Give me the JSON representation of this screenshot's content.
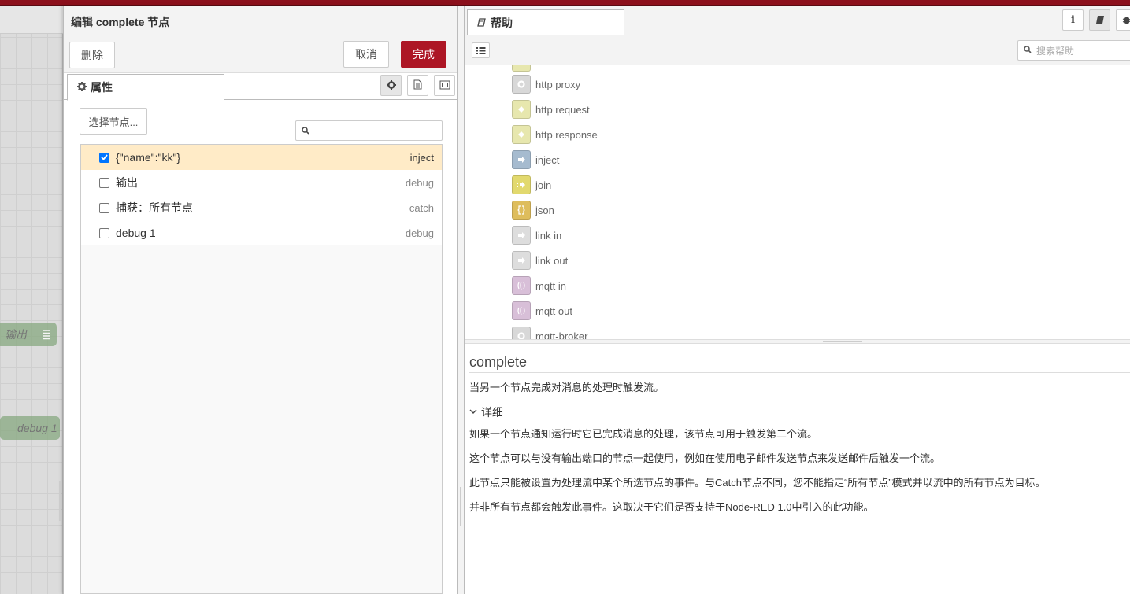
{
  "workspace": {
    "nodes": [
      {
        "label": "输出"
      },
      {
        "label": "debug 1"
      }
    ]
  },
  "tray": {
    "title": "编辑 complete 节点",
    "delete_label": "删除",
    "cancel_label": "取消",
    "done_label": "完成",
    "tab_properties": "属性",
    "select_nodes_label": "选择节点...",
    "search_placeholder": "",
    "nodes": [
      {
        "name": "{\"name\":\"kk\"}",
        "type": "inject",
        "checked": true
      },
      {
        "name": "输出",
        "type": "debug",
        "checked": false
      },
      {
        "name": "捕获：所有节点",
        "type": "catch",
        "checked": false
      },
      {
        "name": "debug 1",
        "type": "debug",
        "checked": false
      }
    ]
  },
  "sidebar": {
    "tab_help": "帮助",
    "search_placeholder": "搜索帮助",
    "palette_items": [
      {
        "label": "http proxy",
        "color": "#d8d8d8"
      },
      {
        "label": "http request",
        "color": "#e7e7ae"
      },
      {
        "label": "http response",
        "color": "#e7e7ae"
      },
      {
        "label": "inject",
        "color": "#a6bbcf"
      },
      {
        "label": "join",
        "color": "#e2d96e"
      },
      {
        "label": "json",
        "color": "#debd5c"
      },
      {
        "label": "link in",
        "color": "#dddddd"
      },
      {
        "label": "link out",
        "color": "#dddddd"
      },
      {
        "label": "mqtt in",
        "color": "#d8bfd8"
      },
      {
        "label": "mqtt out",
        "color": "#d8bfd8"
      },
      {
        "label": "mqtt-broker",
        "color": "#d8d8d8"
      }
    ],
    "help": {
      "title": "complete",
      "summary": "当另一个节点完成对消息的处理时触发流。",
      "details_heading": "详细",
      "paragraphs": [
        "如果一个节点通知运行时它已完成消息的处理，该节点可用于触发第二个流。",
        "这个节点可以与没有输出端口的节点一起使用，例如在使用电子邮件发送节点来发送邮件后触发一个流。",
        "此节点只能被设置为处理流中某个所选节点的事件。与Catch节点不同，您不能指定“所有节点”模式并以流中的所有节点为目标。",
        "并非所有节点都会触发此事件。这取决于它们是否支持于Node-RED 1.0中引入的此功能。"
      ]
    }
  },
  "colors": {
    "brand_red": "#8c101c",
    "done_button": "#ad1625",
    "selected_row": "#ffebc7",
    "checkbox_checked": "#0075ff"
  }
}
